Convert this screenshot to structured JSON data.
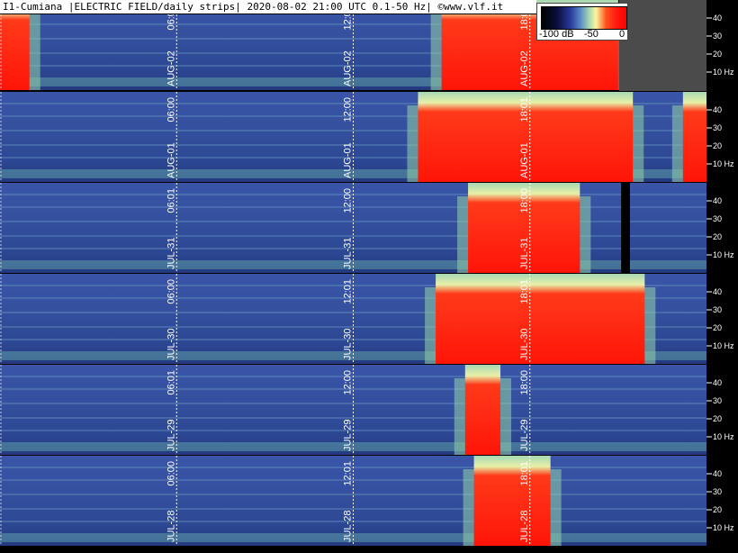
{
  "header": {
    "title": "I1-Cumiana |ELECTRIC FIELD/daily strips| 2020-08-02 21:00 UTC 0.1-50 Hz| ©www.vlf.it"
  },
  "color_scale": {
    "labels": [
      "-100 dB",
      "-50",
      "0"
    ],
    "min_db": -100,
    "max_db": 0
  },
  "colors": {
    "background_low": "#2b3d8f",
    "mid": "#8fc8a8",
    "high": "#ff1a10",
    "panel_grey": "#4b4b4b",
    "gridline": "#ffffff"
  },
  "chart_data": {
    "type": "heatmap",
    "title": "I1-Cumiana |ELECTRIC FIELD/daily strips| 2020-08-02 21:00 UTC 0.1-50 Hz| ©www.vlf.it",
    "ylabel_unit": "Hz",
    "ylim": [
      0,
      50
    ],
    "y_ticks": [
      "40",
      "30",
      "20",
      "10 Hz"
    ],
    "y_tick_values": [
      40,
      30,
      20,
      10
    ],
    "strips": [
      {
        "day": "AUG-02",
        "marker_times": [
          "06:01",
          "12:01",
          "18:00"
        ],
        "marker_hours": [
          6,
          12,
          18
        ],
        "data_end_hour": 21,
        "red_intervals": [
          [
            0,
            1
          ],
          [
            15,
            21
          ]
        ],
        "gap_intervals": []
      },
      {
        "day": "AUG-01",
        "marker_times": [
          "06:00",
          "12:00",
          "18:01"
        ],
        "marker_hours": [
          6,
          12,
          18
        ],
        "data_end_hour": 24,
        "red_intervals": [
          [
            14.2,
            21.5
          ],
          [
            23.2,
            24
          ]
        ],
        "gap_intervals": []
      },
      {
        "day": "JUL-31",
        "marker_times": [
          "06:01",
          "12:00",
          "18:00"
        ],
        "marker_hours": [
          6,
          12,
          18
        ],
        "data_end_hour": 24,
        "red_intervals": [
          [
            15.9,
            19.7
          ]
        ],
        "gap_intervals": [
          [
            21.1,
            21.4
          ]
        ]
      },
      {
        "day": "JUL-30",
        "marker_times": [
          "06:00",
          "12:01",
          "18:01"
        ],
        "marker_hours": [
          6,
          12,
          18
        ],
        "data_end_hour": 24,
        "red_intervals": [
          [
            14.8,
            21.9
          ]
        ],
        "gap_intervals": []
      },
      {
        "day": "JUL-29",
        "marker_times": [
          "06:01",
          "12:00",
          "18:00"
        ],
        "marker_hours": [
          6,
          12,
          18
        ],
        "data_end_hour": 24,
        "red_intervals": [
          [
            15.8,
            17.0
          ]
        ],
        "gap_intervals": []
      },
      {
        "day": "JUL-28",
        "marker_times": [
          "06:00",
          "12:01",
          "18:01"
        ],
        "marker_hours": [
          6,
          12,
          18
        ],
        "data_end_hour": 24,
        "red_intervals": [
          [
            16.1,
            18.7
          ]
        ],
        "gap_intervals": []
      }
    ]
  }
}
